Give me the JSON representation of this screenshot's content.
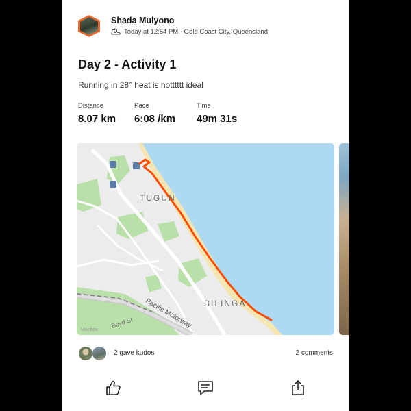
{
  "post": {
    "athlete_name": "Shada Mulyono",
    "activity_icon": "running-shoe-icon",
    "meta": "Today at 12:54 PM · Gold Coast City, Queensland",
    "title": "Day 2 - Activity 1",
    "description": "Running in 28° heat is notttttt ideal"
  },
  "stats": [
    {
      "label": "Distance",
      "value": "8.07 km"
    },
    {
      "label": "Pace",
      "value": "6:08 /km"
    },
    {
      "label": "Time",
      "value": "49m 31s"
    }
  ],
  "map": {
    "labels": {
      "suburb_1": "TUGUN",
      "suburb_2": "BILINGA",
      "road_1": "Pacific Motorway",
      "road_2": "Boyd St",
      "attribution": "Mapbox"
    },
    "colors": {
      "route": "#fc4c02",
      "water": "#aed9f3",
      "land": "#ececec",
      "park": "#b8e0a8",
      "beach": "#f4e6b3"
    }
  },
  "social": {
    "kudos": "2 gave kudos",
    "comments": "2 comments"
  },
  "actions": {
    "kudos_icon": "thumbs-up-icon",
    "comment_icon": "comment-icon",
    "share_icon": "share-icon"
  }
}
